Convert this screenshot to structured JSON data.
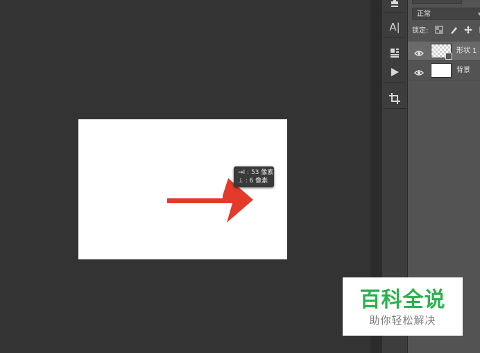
{
  "workspace": {
    "tooltip": {
      "line1": "→I : 53 像素",
      "line2": "⊥ :   6 像素"
    },
    "canvas_color": "#ffffff",
    "arrow_color": "#e33a2c"
  },
  "toolstrip": {
    "tools": [
      {
        "name": "stamp-icon",
        "glyph": "≜"
      },
      {
        "name": "character-icon",
        "glyph": "A|"
      },
      {
        "name": "paragraph-icon",
        "glyph": "≣"
      },
      {
        "name": "play-icon",
        "glyph": "▶"
      },
      {
        "name": "crop-icon",
        "glyph": "⌗"
      }
    ]
  },
  "layers_panel": {
    "blend_mode": "正常",
    "lock_label": "锁定:",
    "layers": [
      {
        "name": "形状 1",
        "selected": true,
        "thumbnail": "transparent"
      },
      {
        "name": "背景",
        "selected": false,
        "thumbnail": "white"
      }
    ]
  },
  "watermark": {
    "title": "百科全说",
    "subtitle": "助你轻松解决",
    "title_color": "#2bb24c"
  }
}
